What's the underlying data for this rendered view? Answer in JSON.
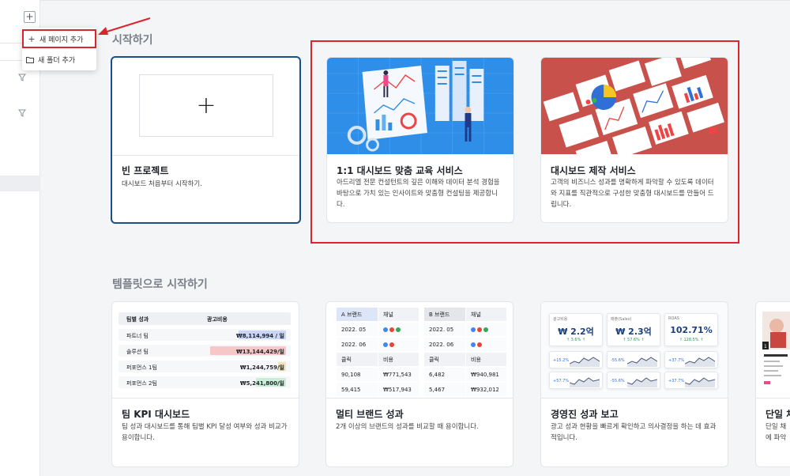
{
  "menu": {
    "add_page_label": "새 페이지 추가",
    "add_folder_label": "새 폴더 추가"
  },
  "sections": {
    "start_title": "시작하기",
    "template_title": "템플릿으로 시작하기"
  },
  "cards": {
    "blank": {
      "title": "빈 프로젝트",
      "desc": "대시보드 처음부터 시작하기."
    },
    "edu": {
      "title": "1:1 대시보드 맞춤 교육 서비스",
      "desc": "아드리엘 전문 컨설턴트의 깊은 이해와 데이터 분석 경험을 바탕으로 가치 있는 인사이트와 맞춤형 컨설팅을 제공합니다."
    },
    "make": {
      "title": "대시보드 제작 서비스",
      "desc": "고객의 비즈니스 성과를 명확하게 파악할 수 있도록 데이터와 지표를 직관적으로 구성한 맞춤형 대시보드를 만들어 드립니다."
    },
    "kpi": {
      "title": "팀 KPI 대시보드",
      "desc": "팀 성과 대시보드를 통해 팀별 KPI 달성 여부와 성과 비교가 용이합니다."
    },
    "multi": {
      "title": "멀티 브랜드 성과",
      "desc": "2개 이상의 브랜드의 성과를 비교할 때 용이합니다."
    },
    "exec": {
      "title": "경영진 성과 보고",
      "desc": "광고 성과 현황을 빠르게 확인하고 의사결정을 하는 데 효과적입니다."
    },
    "single": {
      "title": "단일 채",
      "desc_line1": "단일 채",
      "desc_line2": "에 파악"
    }
  },
  "kpi_preview": {
    "headers": [
      "팀별 성과",
      "광고비용"
    ],
    "rows": [
      {
        "team": "파트너 팀",
        "cost": "₩8,114,994 / 일",
        "pct": 0.62,
        "color": "#c9d6f5"
      },
      {
        "team": "솔루션 팀",
        "cost": "₩13,144,429/일",
        "pct": 1.0,
        "color": "#f6c7c7"
      },
      {
        "team": "퍼포먼스 1팀",
        "cost": "₩1,244,759/일",
        "pct": 0.1,
        "color": "#f1e3b8"
      },
      {
        "team": "퍼포먼스 2팀",
        "cost": "₩5,241,800/일",
        "pct": 0.4,
        "color": "#c9efd8"
      }
    ]
  },
  "multi_preview": {
    "a": {
      "brand": "A 브랜드",
      "channel": "채널",
      "d1": "2022. 05",
      "d2": "2022. 06",
      "click": "클릭",
      "cost": "비용",
      "c1": "90,108",
      "v1": "₩771,543",
      "c2": "59,415",
      "v2": "₩517,943"
    },
    "b": {
      "brand": "B 브랜드",
      "channel": "채널",
      "d1": "2022. 05",
      "d2": "2022. 06",
      "click": "클릭",
      "cost": "비용",
      "c1": "6,482",
      "v1": "₩940,981",
      "c2": "5,467",
      "v2": "₩932,012"
    }
  },
  "exec_preview": {
    "kpis": [
      {
        "label": "광고비용",
        "value": "₩ 2.2억",
        "sub": "↑ 3.6% ↑"
      },
      {
        "label": "매출(Sales)",
        "value": "₩ 2.3억",
        "sub": "↑ 57.6% ↑"
      },
      {
        "label": "ROAS",
        "value": "102.71%",
        "sub": "↑ 128.5% ↑"
      }
    ],
    "small": [
      "+15.2%",
      "-55.6%",
      "+37.7%",
      "+57.7%",
      "-55.6%",
      "+37.7%"
    ]
  },
  "colors": {
    "accent_red": "#d9262e",
    "blank_border": "#1b4e8c",
    "edu_bg": "#2196f3",
    "make_bg": "#c9514b"
  }
}
